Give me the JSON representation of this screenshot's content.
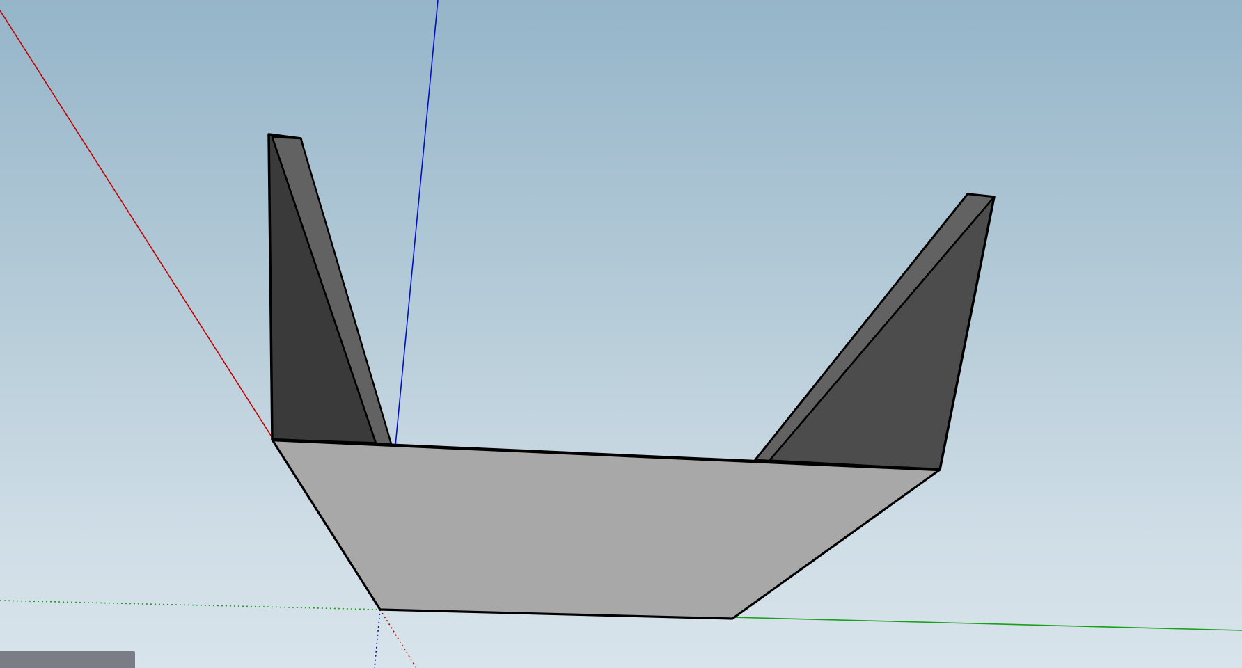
{
  "app": {
    "kind": "3d-modeling-viewport"
  },
  "colors": {
    "sky_top": "#95b5c9",
    "sky_bottom": "#d8e4eb",
    "axis_red": "#c00000",
    "axis_green": "#1a9f1a",
    "axis_blue": "#0010c8",
    "face_front": "#a8a8a8",
    "face_dark": "#3a3a3a",
    "face_mid": "#4c4c4c",
    "face_edge_band": "#626262",
    "edge": "#000000",
    "status_panel": "#7b7d86"
  },
  "icons": {
    "axes": "xyz-axes-icon"
  }
}
